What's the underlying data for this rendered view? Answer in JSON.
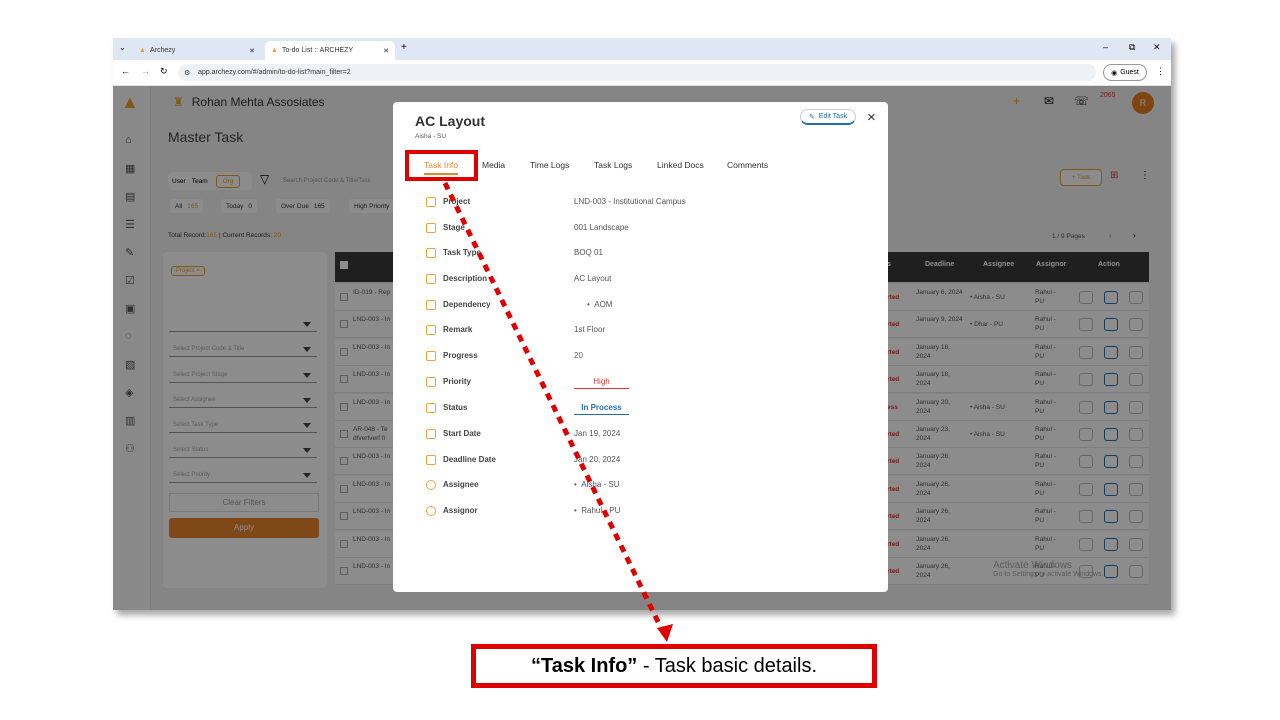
{
  "browser": {
    "tabs": [
      {
        "label": "Archezy"
      },
      {
        "label": "To-do List :: ARCHEZY"
      }
    ],
    "url": "app.archezy.com/#/admin/to-do-list?main_filter=2",
    "guest_label": "Guest"
  },
  "header": {
    "org_name": "Rohan Mehta Assosiates",
    "notification_count": "2065",
    "avatar_letter": "R"
  },
  "page": {
    "title": "Master Task",
    "toggle": {
      "user": "User",
      "team": "Team",
      "org": "Org"
    },
    "search_placeholder": "Search Project Code & Title/Task",
    "filters": [
      {
        "label": "All",
        "count": "165"
      },
      {
        "label": "Today",
        "count": "0"
      },
      {
        "label": "Over Due",
        "count": "165"
      },
      {
        "label": "High Priority",
        "count": ""
      }
    ],
    "total_records_label": "Total Record:",
    "total_records": "165",
    "current_records_label": "| Current Records:",
    "current_records": "20",
    "pages": "1 / 9 Pages",
    "add_task": "+ Task"
  },
  "sidebar_filters": {
    "project_chip": "Project",
    "selects": [
      "Select Project Code & Title",
      "Select Project Stage",
      "Select Assignee",
      "Select Task Type",
      "Select Status",
      "Select Priority"
    ],
    "clear": "Clear Filters",
    "apply": "Apply"
  },
  "table": {
    "headers": {
      "status": "s",
      "deadline": "Deadline",
      "assignee": "Assignee",
      "assignor": "Assignor",
      "action": "Action"
    },
    "rows": [
      {
        "project": "ID-019 - Rep",
        "status": "rted",
        "deadline": "January 6, 2024",
        "assignee": "Aisha - SU",
        "assignor": "Rahul - PU"
      },
      {
        "project": "LND-003 - In",
        "status": "rted",
        "deadline": "January 9, 2024",
        "assignee": "Dhar - PU",
        "assignor": "Rahul - PU"
      },
      {
        "project": "LND-003 - In",
        "status": "rted",
        "deadline": "January 18, 2024",
        "assignee": "",
        "assignor": "Rahul - PU"
      },
      {
        "project": "LND-003 - In",
        "status": "rted",
        "deadline": "January 18, 2024",
        "assignee": "",
        "assignor": "Rahul - PU"
      },
      {
        "project": "LND-003 - In",
        "status": "ess",
        "deadline": "January 20, 2024",
        "assignee": "Aisha - SU",
        "assignor": "Rahul - PU"
      },
      {
        "project": "AR-048 - Te dfverfverf fi",
        "status": "rted",
        "deadline": "January 23, 2024",
        "assignee": "Aisha - SU",
        "assignor": "Rahul - PU"
      },
      {
        "project": "LND-003 - In",
        "status": "rted",
        "deadline": "January 26, 2024",
        "assignee": "",
        "assignor": "Rahul - PU"
      },
      {
        "project": "LND-003 - In",
        "status": "rted",
        "deadline": "January 26, 2024",
        "assignee": "",
        "assignor": "Rahul - PU"
      },
      {
        "project": "LND-003 - In",
        "status": "rted",
        "deadline": "January 26, 2024",
        "assignee": "",
        "assignor": "Rahul - PU"
      },
      {
        "project": "LND-003 - In",
        "status": "rted",
        "deadline": "January 26, 2024",
        "assignee": "",
        "assignor": "Rahul - PU"
      },
      {
        "project": "LND-003 - In",
        "status": "rted",
        "deadline": "January 26, 2024",
        "assignee": "",
        "assignor": "Rahul - PU"
      }
    ]
  },
  "watermark": {
    "line1": "Activate Windows",
    "line2": "Go to Settings to activate Windows."
  },
  "modal": {
    "title": "AC Layout",
    "subtitle": "Aisha - SU",
    "edit_label": "Edit Task",
    "close": "×",
    "tabs": [
      "Task Info",
      "Media",
      "Time Logs",
      "Task Logs",
      "Linked Docs",
      "Comments"
    ],
    "fields": [
      {
        "label": "Project",
        "value": "LND-003 - Institutional Campus"
      },
      {
        "label": "Stage",
        "value": "001 Landscape"
      },
      {
        "label": "Task Type",
        "value": "BOQ 01"
      },
      {
        "label": "Description",
        "value": "AC Layout"
      },
      {
        "label": "Dependency",
        "value": "AOM"
      },
      {
        "label": "Remark",
        "value": "1st Floor"
      },
      {
        "label": "Progress",
        "value": "20"
      },
      {
        "label": "Priority",
        "value": "High"
      },
      {
        "label": "Status",
        "value": "In Process"
      },
      {
        "label": "Start Date",
        "value": "Jan 19, 2024"
      },
      {
        "label": "Deadline Date",
        "value": "Jan 20, 2024"
      },
      {
        "label": "Assignee",
        "value": "Aisha - SU"
      },
      {
        "label": "Assignor",
        "value": "Rahul - PU"
      }
    ]
  },
  "callout": {
    "bold": "“Task Info”",
    "rest": " - Task basic details."
  },
  "colors": {
    "accent": "#f0a53c",
    "highlight": "#e00000",
    "status_blue": "#1f6fb0",
    "priority_red": "#d33"
  }
}
